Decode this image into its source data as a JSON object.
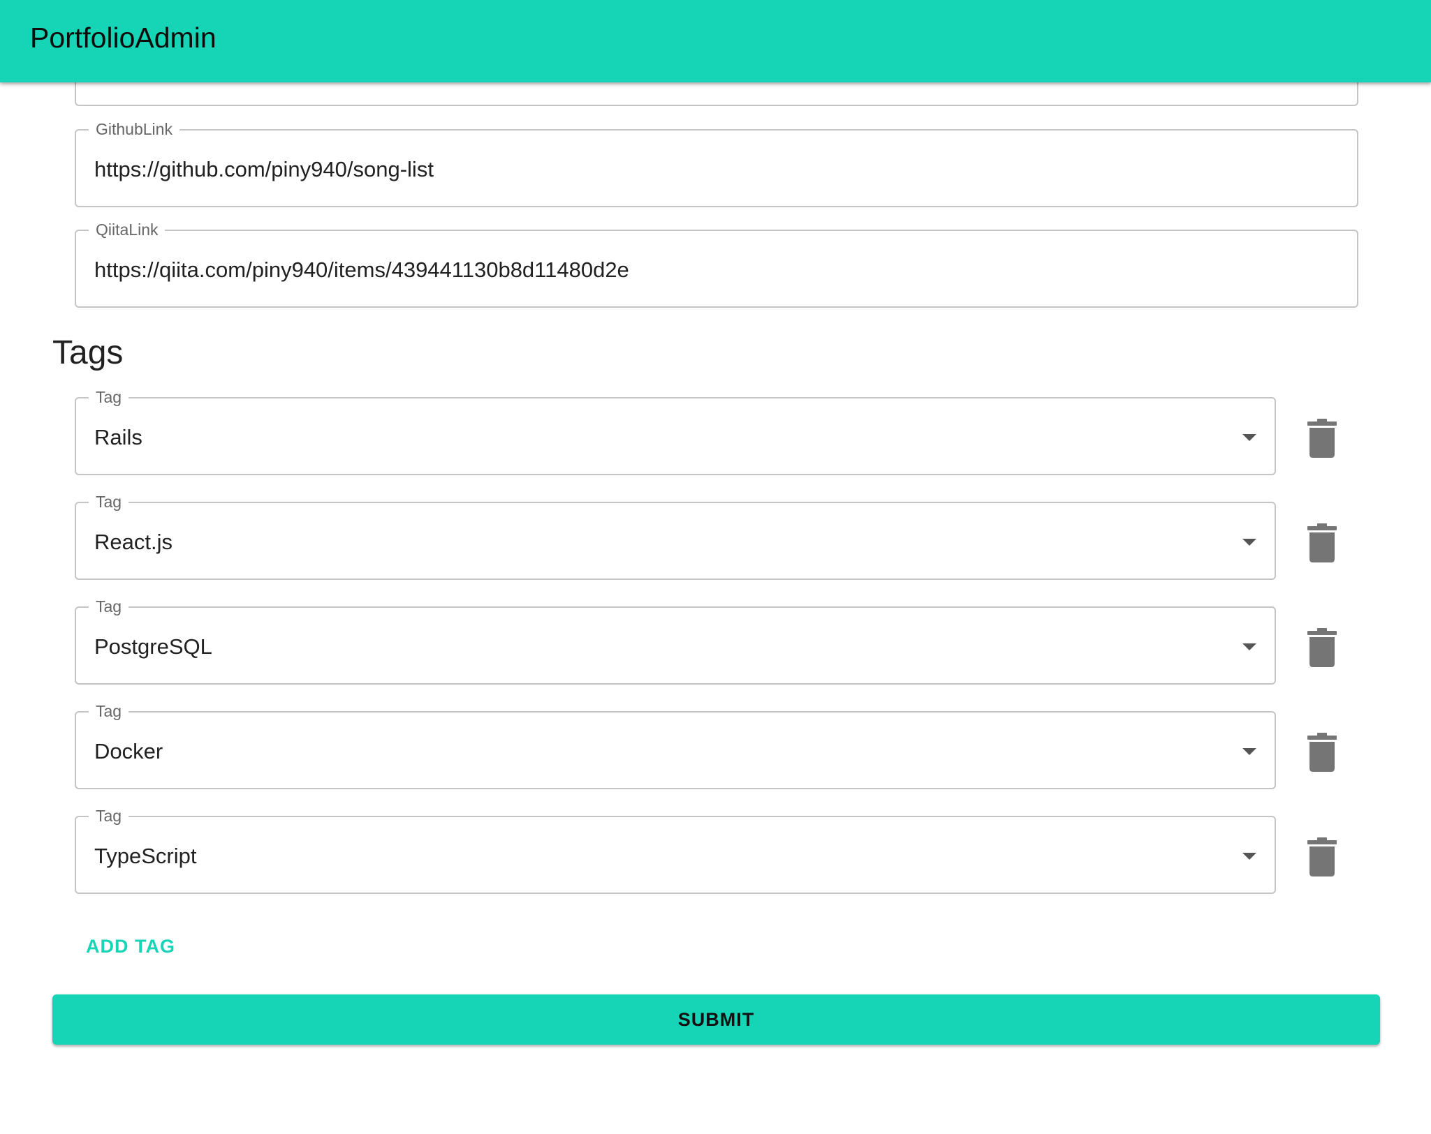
{
  "appbar": {
    "title": "PortfolioAdmin",
    "color": "#15d5b6"
  },
  "fields": {
    "github": {
      "label": "GithubLink",
      "value": "https://github.com/piny940/song-list"
    },
    "qiita": {
      "label": "QiitaLink",
      "value": "https://qiita.com/piny940/items/439441130b8d11480d2e"
    }
  },
  "tags_section": {
    "title": "Tags",
    "tags": [
      {
        "label": "Tag",
        "value": "Rails",
        "delete_icon": "trash-icon"
      },
      {
        "label": "Tag",
        "value": "React.js",
        "delete_icon": "trash-icon"
      },
      {
        "label": "Tag",
        "value": "PostgreSQL",
        "delete_icon": "trash-icon"
      },
      {
        "label": "Tag",
        "value": "Docker",
        "delete_icon": "trash-icon"
      },
      {
        "label": "Tag",
        "value": "TypeScript",
        "delete_icon": "trash-icon"
      }
    ],
    "add_label": "ADD TAG"
  },
  "submit_label": "SUBMIT"
}
